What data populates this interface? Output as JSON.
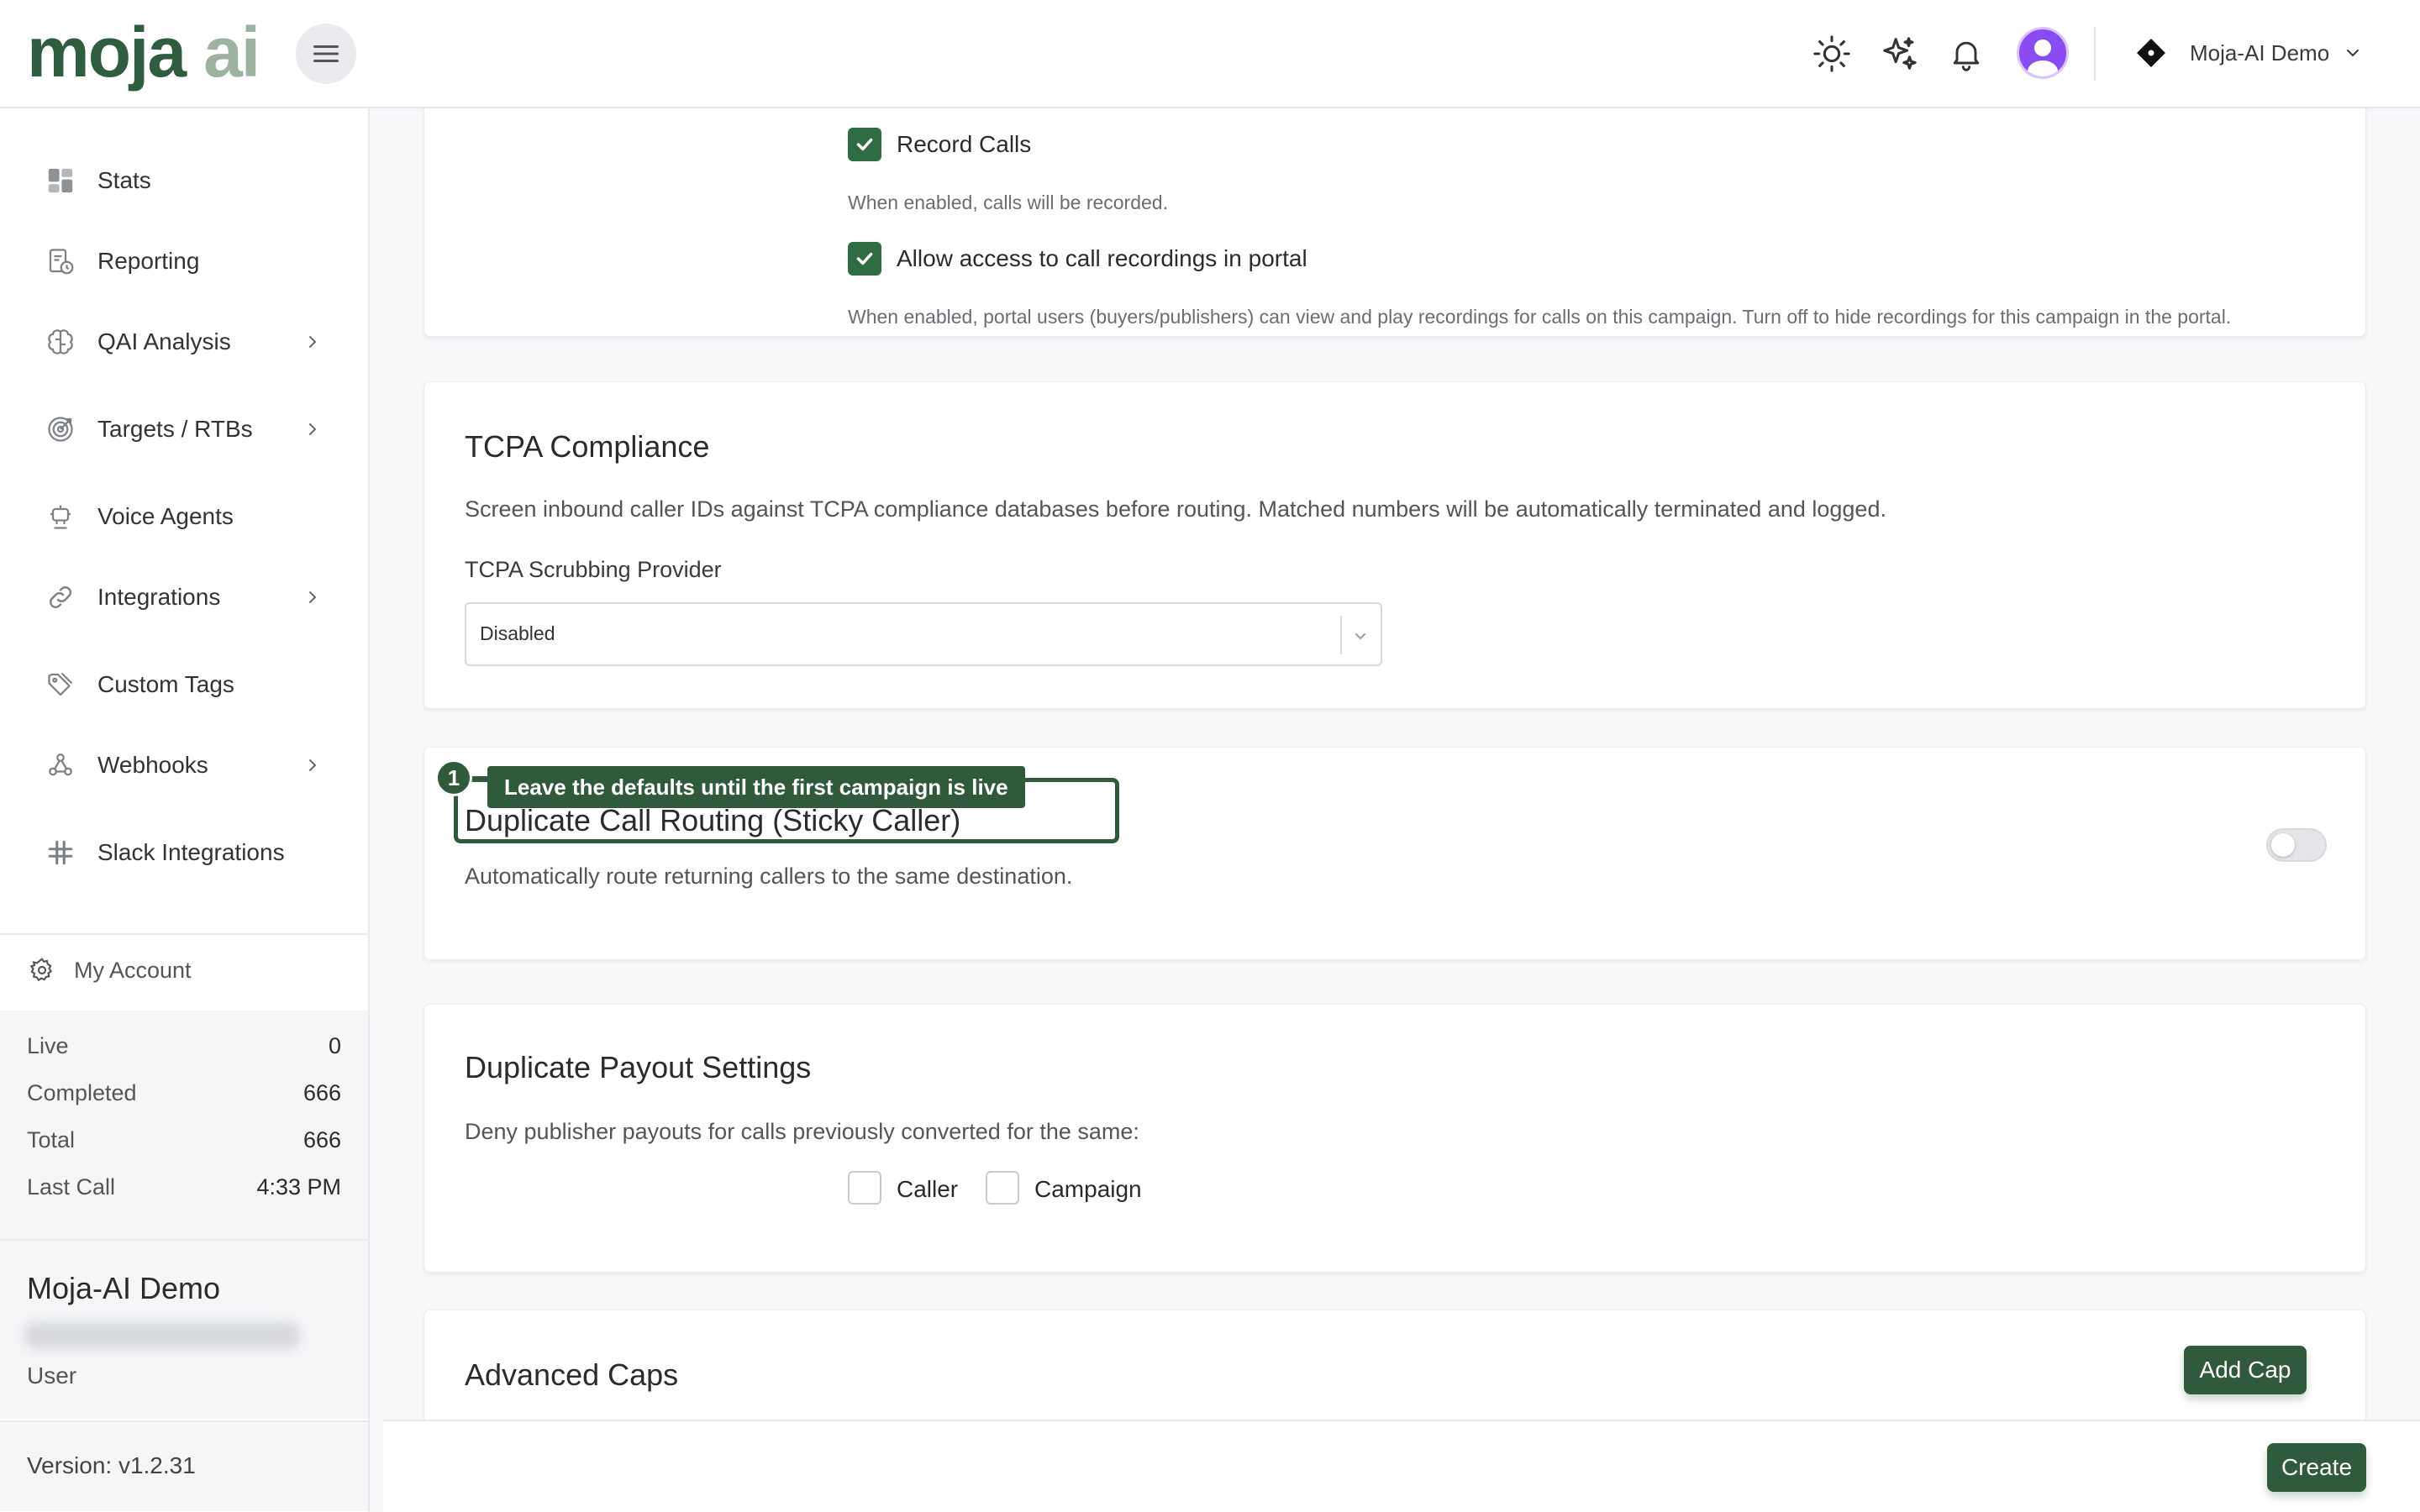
{
  "brand": {
    "logo_part1": "moja",
    "logo_part2": "ai"
  },
  "header": {
    "org_name": "Moja-AI Demo"
  },
  "sidebar": {
    "items": [
      {
        "label": "Stats",
        "icon": "dashboard-icon",
        "expandable": false
      },
      {
        "label": "Reporting",
        "icon": "report-clock-icon",
        "expandable": false
      },
      {
        "label": "QAI Analysis",
        "icon": "brain-icon",
        "expandable": true
      },
      {
        "label": "Targets / RTBs",
        "icon": "target-icon",
        "expandable": true
      },
      {
        "label": "Voice Agents",
        "icon": "robot-icon",
        "expandable": false
      },
      {
        "label": "Integrations",
        "icon": "link-icon",
        "expandable": true
      },
      {
        "label": "Custom Tags",
        "icon": "tags-icon",
        "expandable": false
      },
      {
        "label": "Webhooks",
        "icon": "webhook-icon",
        "expandable": true
      },
      {
        "label": "Slack Integrations",
        "icon": "slack-icon",
        "expandable": false
      }
    ],
    "account_label": "My Account",
    "stats": [
      {
        "label": "Live",
        "value": "0"
      },
      {
        "label": "Completed",
        "value": "666"
      },
      {
        "label": "Total",
        "value": "666"
      },
      {
        "label": "Last Call",
        "value": "4:33 PM"
      }
    ],
    "user": {
      "org": "Moja-AI Demo",
      "role": "User"
    },
    "version": "Version: v1.2.31"
  },
  "recording": {
    "record_calls_label": "Record Calls",
    "record_calls_checked": true,
    "record_calls_help": "When enabled, calls will be recorded.",
    "portal_access_label": "Allow access to call recordings in portal",
    "portal_access_checked": true,
    "portal_access_help": "When enabled, portal users (buyers/publishers) can view and play recordings for calls on this campaign. Turn off to hide recordings for this campaign in the portal."
  },
  "tcpa": {
    "title": "TCPA Compliance",
    "description": "Screen inbound caller IDs against TCPA compliance databases before routing. Matched numbers will be automatically terminated and logged.",
    "provider_label": "TCPA Scrubbing Provider",
    "provider_value": "Disabled"
  },
  "sticky": {
    "title": "Duplicate Call Routing (Sticky Caller)",
    "description": "Automatically route returning callers to the same destination.",
    "enabled": false
  },
  "tour": {
    "step": "1",
    "tip": "Leave the defaults until the first campaign is live"
  },
  "payout": {
    "title": "Duplicate Payout Settings",
    "description": "Deny publisher payouts for calls previously converted for the same:",
    "options": [
      {
        "label": "Caller",
        "checked": false
      },
      {
        "label": "Campaign",
        "checked": false
      }
    ]
  },
  "caps": {
    "title": "Advanced Caps",
    "add_label": "Add Cap"
  },
  "footer": {
    "create_label": "Create"
  },
  "colors": {
    "primary": "#2f5a3c",
    "checkbox": "#2f6b43",
    "logo_dark": "#2e5d3f",
    "logo_light": "#9db39f",
    "avatar": "#8a4cf0"
  }
}
